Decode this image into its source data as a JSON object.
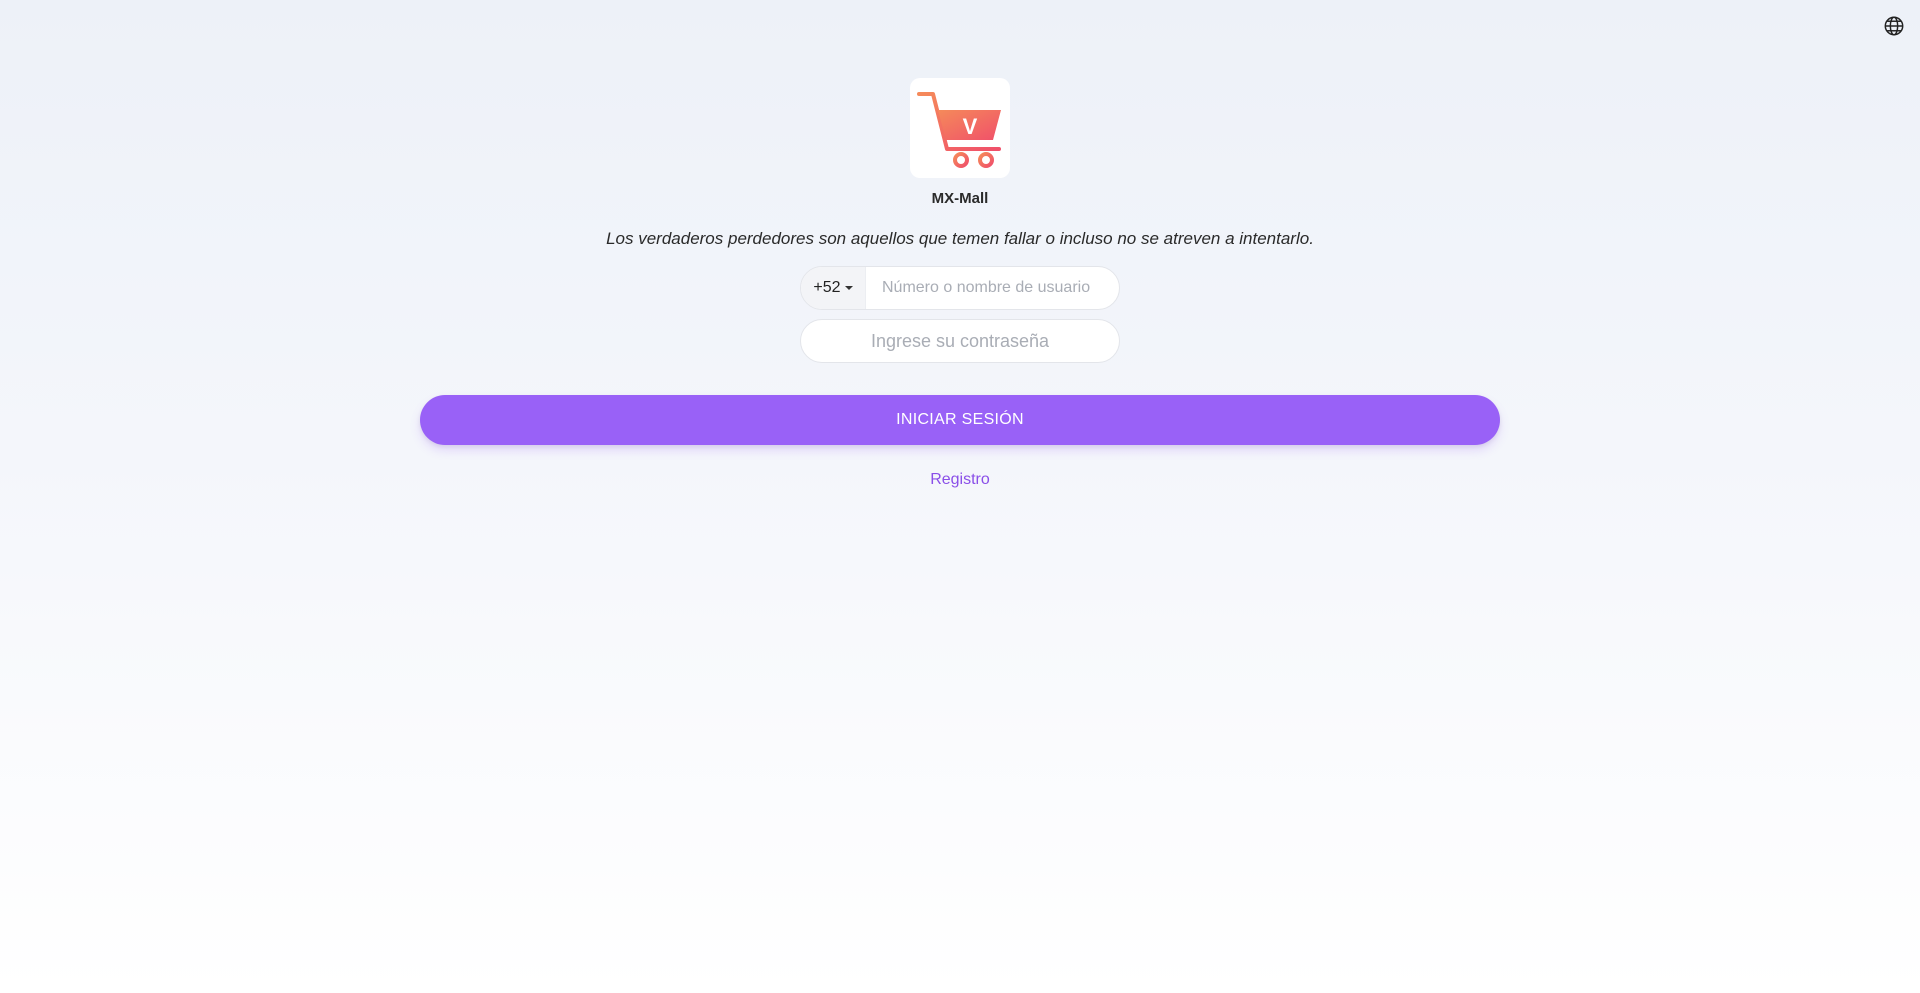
{
  "header": {
    "language_icon": "globe-icon"
  },
  "brand": {
    "logo_icon": "shopping-cart-logo",
    "logo_letter": "V",
    "app_name": "MX-Mall"
  },
  "slogan": "Los verdaderos perdedores son aquellos que temen fallar o incluso no se atreven a intentarlo.",
  "login_form": {
    "country_code": "+52",
    "username_placeholder": "Número o nombre de usuario",
    "username_value": "",
    "password_placeholder": "Ingrese su contraseña",
    "password_value": "",
    "submit_label": "INICIAR SESIÓN",
    "register_label": "Registro"
  },
  "colors": {
    "accent": "#9961f7",
    "link": "#8a4fe8",
    "logo_gradient_start": "#f58a5a",
    "logo_gradient_end": "#f0506a"
  }
}
